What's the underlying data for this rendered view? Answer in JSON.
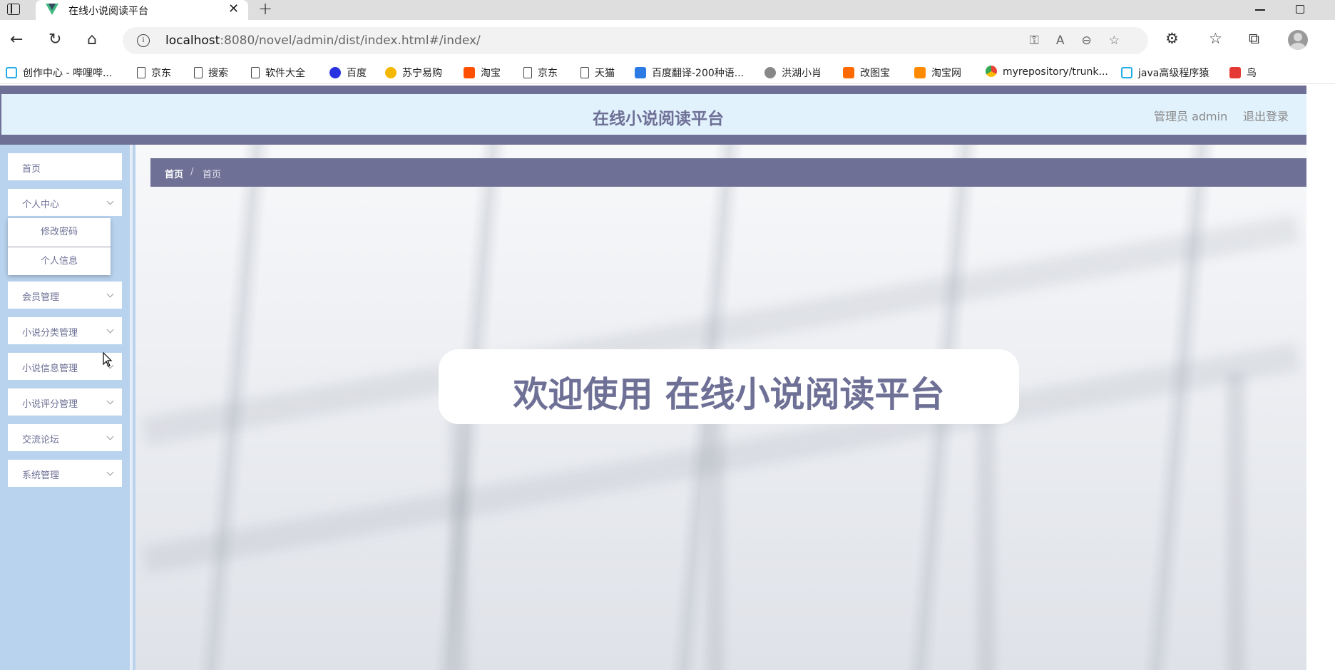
{
  "browser": {
    "tab_title": "在线小说阅读平台",
    "url_host": "localhost",
    "url_path": ":8080/novel/admin/dist/index.html#/index/",
    "bookmarks": [
      {
        "label": "创作中心 - 哔哩哔...",
        "icon": "bilibili-icon"
      },
      {
        "label": "京东",
        "icon": "page-icon"
      },
      {
        "label": "搜索",
        "icon": "page-icon"
      },
      {
        "label": "软件大全",
        "icon": "page-icon"
      },
      {
        "label": "百度",
        "icon": "baidu-icon"
      },
      {
        "label": "苏宁易购",
        "icon": "suning-icon"
      },
      {
        "label": "淘宝",
        "icon": "taobao-icon"
      },
      {
        "label": "京东",
        "icon": "page-icon"
      },
      {
        "label": "天猫",
        "icon": "page-icon"
      },
      {
        "label": "百度翻译-200种语...",
        "icon": "baidu-translate-icon"
      },
      {
        "label": "洪湖小肖",
        "icon": "bird-icon"
      },
      {
        "label": "改图宝",
        "icon": "gaitubao-icon"
      },
      {
        "label": "淘宝网",
        "icon": "taobao-icon"
      },
      {
        "label": "myrepository/trunk...",
        "icon": "chrome-icon"
      },
      {
        "label": "java高级程序猿",
        "icon": "bilibili-icon"
      },
      {
        "label": "鸟",
        "icon": "bird-red-icon"
      }
    ]
  },
  "header": {
    "title": "在线小说阅读平台",
    "admin_label": "管理员 admin",
    "logout_label": "退出登录"
  },
  "sidebar": {
    "items": [
      {
        "label": "首页",
        "has_children": false
      },
      {
        "label": "个人中心",
        "has_children": true
      },
      {
        "label": "会员管理",
        "has_children": true
      },
      {
        "label": "小说分类管理",
        "has_children": true
      },
      {
        "label": "小说信息管理",
        "has_children": true
      },
      {
        "label": "小说评分管理",
        "has_children": true
      },
      {
        "label": "交流论坛",
        "has_children": true
      },
      {
        "label": "系统管理",
        "has_children": true
      }
    ],
    "submenu": [
      "修改密码",
      "个人信息"
    ]
  },
  "breadcrumb": [
    "首页",
    "首页"
  ],
  "breadcrumb_separator": "/",
  "welcome": "欢迎使用 在线小说阅读平台",
  "colors": {
    "primary": "#6e7096",
    "sidebar_bg": "#b9d3ee",
    "header_bg": "#e2f2fd"
  }
}
